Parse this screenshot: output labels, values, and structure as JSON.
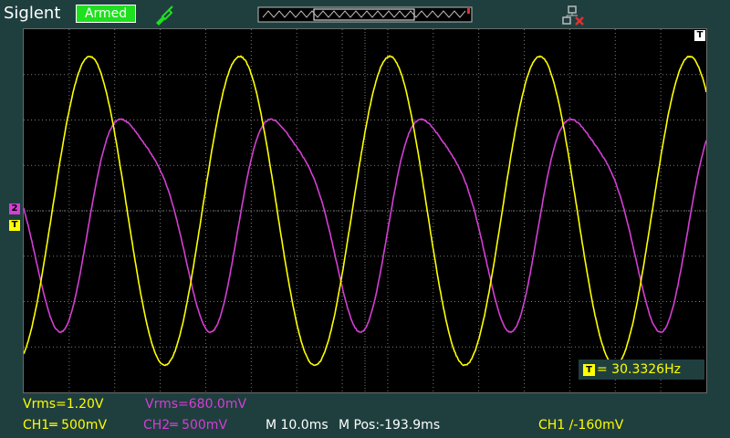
{
  "topbar": {
    "brand": "Siglent",
    "status": "Armed",
    "icons": [
      "probe-icon",
      "trigger-position-bar",
      "network-disconnected-icon"
    ]
  },
  "markers": {
    "ch2_marker": "2",
    "trigger_level_marker": "T",
    "trigger_position_marker": "T"
  },
  "measurements": {
    "ch1_vrms": "Vrms=1.20V",
    "ch2_vrms": "Vrms=680.0mV",
    "frequency_icon": "T",
    "frequency": "= 30.3326Hz"
  },
  "status_line": {
    "ch1": "CH1═ 500mV",
    "ch2": "CH2═ 500mV",
    "timebase": "M 10.0ms",
    "mpos": "M Pos:-193.9ms",
    "trigger": "CH1 ∕-160mV"
  },
  "colors": {
    "background": "#1f3f3f",
    "screen": "#000000",
    "grid": "#7a7a7a",
    "ch1": "#ffff00",
    "ch2": "#d43fd4",
    "status_armed": "#1fe01f"
  },
  "waveforms": {
    "frequency_hz": 30.3326,
    "time_per_div_ms": 10.0,
    "ch1": {
      "amplitude_div": 3.4,
      "volts_per_div_mv": 500,
      "shape": "sine"
    },
    "ch2": {
      "amplitude_div": 2.35,
      "volts_per_div_mv": 500,
      "shape": "distorted-sine"
    }
  }
}
